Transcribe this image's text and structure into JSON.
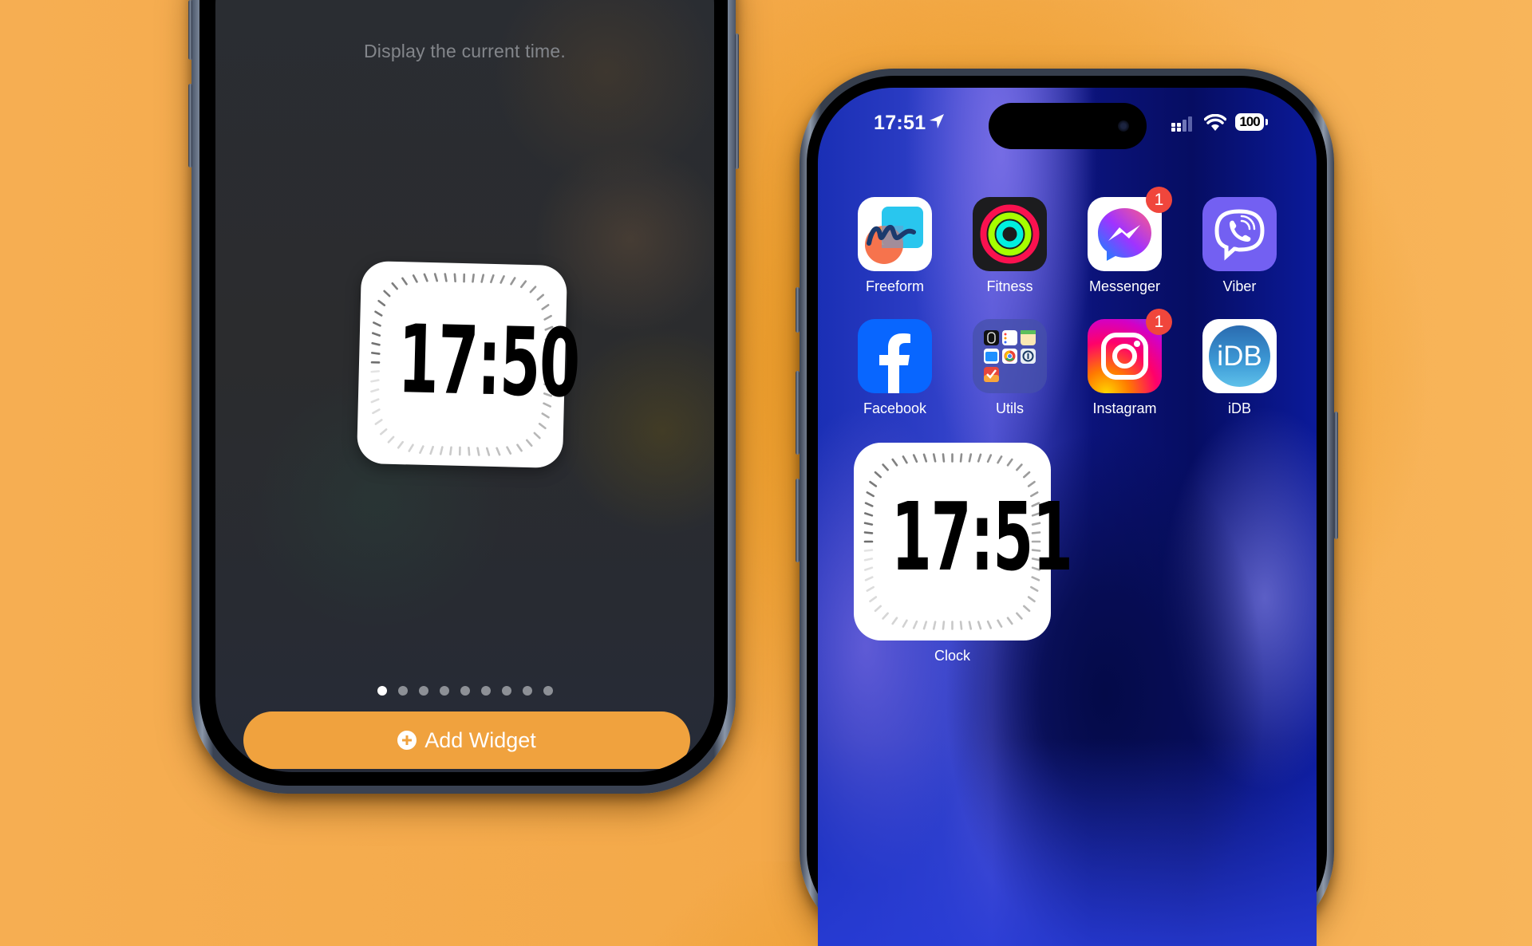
{
  "left_phone": {
    "widget_description": "Display the current time.",
    "widget_time": "17:50",
    "page_dots": {
      "count": 9,
      "active_index": 0
    },
    "add_widget_button": {
      "label": "Add Widget",
      "icon": "plus-circle-icon"
    },
    "accent_color": "#f0a23e"
  },
  "right_phone": {
    "status_bar": {
      "time": "17:51",
      "location_icon": "location-arrow-icon",
      "signal_icon": "cellular-signal-icon",
      "wifi_icon": "wifi-icon",
      "battery": "100"
    },
    "apps": [
      {
        "name": "Freeform",
        "icon": "freeform-icon",
        "badge": null
      },
      {
        "name": "Fitness",
        "icon": "fitness-rings-icon",
        "badge": null
      },
      {
        "name": "Messenger",
        "icon": "messenger-icon",
        "badge": "1"
      },
      {
        "name": "Viber",
        "icon": "viber-icon",
        "badge": null
      },
      {
        "name": "Facebook",
        "icon": "facebook-icon",
        "badge": null
      },
      {
        "name": "Utils",
        "icon": "folder-icon",
        "badge": null
      },
      {
        "name": "Instagram",
        "icon": "instagram-icon",
        "badge": "1"
      },
      {
        "name": "iDB",
        "icon": "idb-icon",
        "badge": null,
        "icon_text": "iDB"
      }
    ],
    "clock_widget": {
      "time": "17:51",
      "label": "Clock"
    },
    "badge_color": "#f0463c"
  }
}
